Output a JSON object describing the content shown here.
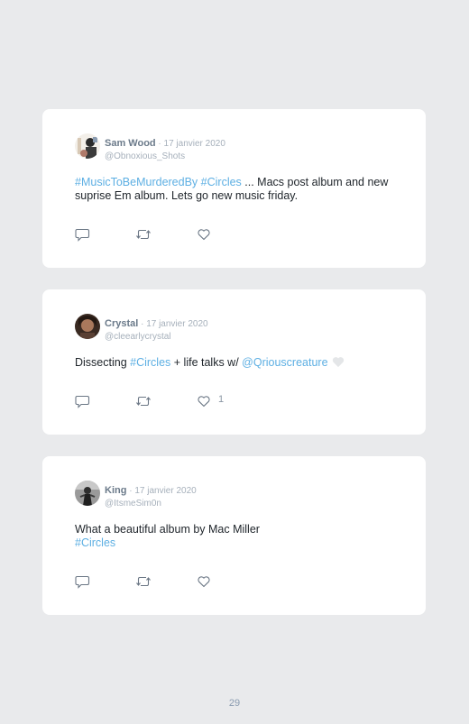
{
  "tweets": [
    {
      "name": "Sam Wood",
      "separator": " · ",
      "date": "17 janvier 2020",
      "handle": "@Obnoxious_Shots",
      "text": [
        {
          "type": "hashtag",
          "text": "#MusicToBeMurderedBy"
        },
        {
          "type": "text",
          "text": " "
        },
        {
          "type": "hashtag",
          "text": "#Circles"
        },
        {
          "type": "text",
          "text": " ... Macs post album and new suprise Em album. Lets go new music friday."
        }
      ],
      "like_count": ""
    },
    {
      "name": "Crystal",
      "separator": " · ",
      "date": "17 janvier 2020",
      "handle": "@cleearlycrystal",
      "text": [
        {
          "type": "text",
          "text": "Dissecting "
        },
        {
          "type": "hashtag",
          "text": "#Circles"
        },
        {
          "type": "text",
          "text": " + life talks w/ "
        },
        {
          "type": "hashtag",
          "text": "@Qriouscreature"
        },
        {
          "type": "emoji",
          "text": "heart"
        }
      ],
      "like_count": "1"
    },
    {
      "name": "King",
      "separator": " · ",
      "date": "17 janvier 2020",
      "handle": "@ItsmeSim0n",
      "text": [
        {
          "type": "text",
          "text": "What a beautiful album by Mac Miller"
        },
        {
          "type": "break",
          "text": ""
        },
        {
          "type": "hashtag",
          "text": "#Circles"
        }
      ],
      "like_count": ""
    }
  ],
  "icons": {
    "reply": "reply-icon",
    "retweet": "retweet-icon",
    "like": "heart-icon"
  },
  "colors": {
    "hashtag": "#5dafe3",
    "text": "#1d2329",
    "meta": "#a6b0bb",
    "icon": "#6b7785"
  },
  "page_number": "29"
}
